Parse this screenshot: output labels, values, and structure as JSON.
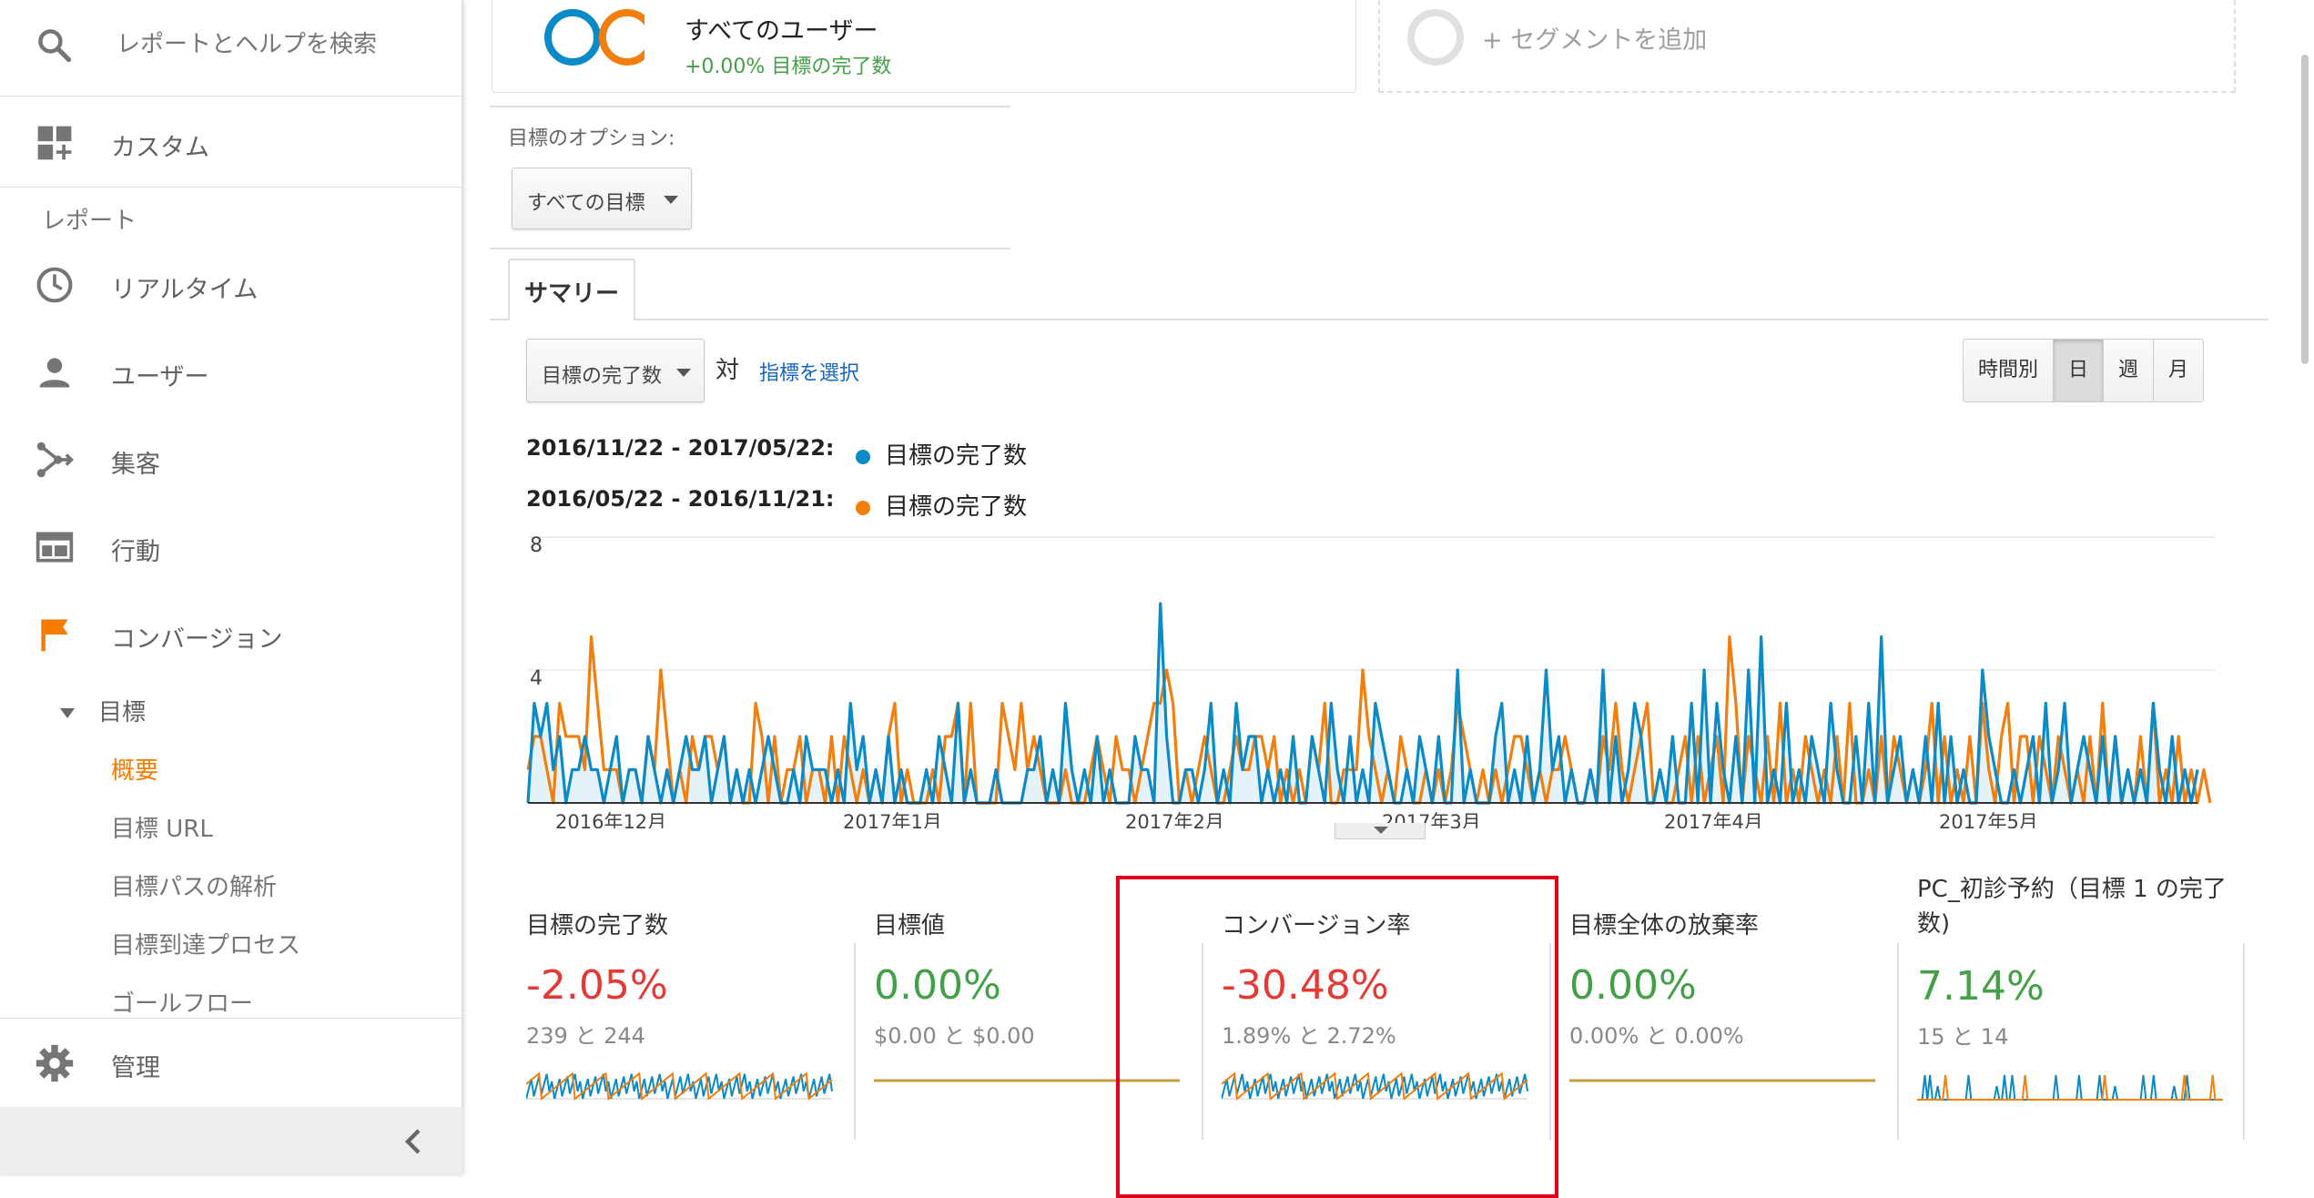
{
  "sidebar": {
    "search_label": "レポートとヘルプを検索",
    "custom_label": "カスタム",
    "reports_section": "レポート",
    "items": [
      {
        "label": "リアルタイム",
        "icon": "clock-icon"
      },
      {
        "label": "ユーザー",
        "icon": "person-icon"
      },
      {
        "label": "集客",
        "icon": "acquisition-icon"
      },
      {
        "label": "行動",
        "icon": "behavior-icon"
      },
      {
        "label": "コンバージョン",
        "icon": "flag-icon"
      }
    ],
    "goal_label": "目標",
    "goal_subitems": [
      "概要",
      "目標 URL",
      "目標パスの解析",
      "目標到達プロセス",
      "ゴールフロー"
    ],
    "admin_label": "管理",
    "accent_color": "#f57c00"
  },
  "segment": {
    "title": "すべてのユーザー",
    "subtitle": "+0.00% 目標の完了数",
    "add_label": "+ セグメントを追加"
  },
  "goal_options": {
    "label": "目標のオプション:",
    "selected": "すべての目標"
  },
  "tab": {
    "summary": "サマリー"
  },
  "controls": {
    "metric_selected": "目標の完了数",
    "vs_label": "対",
    "select_metric_link": "指標を選択",
    "time_buttons": [
      "時間別",
      "日",
      "週",
      "月"
    ],
    "selected_time": "日"
  },
  "legend": {
    "range1": "2016/11/22 - 2017/05/22:",
    "range2": "2016/05/22 - 2016/11/21:",
    "series1_name": "目標の完了数",
    "series2_name": "目標の完了数",
    "series1_color": "#0a8ac6",
    "series2_color": "#f17e0d"
  },
  "chart_data": {
    "type": "line",
    "ylabels": [
      "8",
      "4"
    ],
    "xlabels": [
      "2016年12月",
      "2017年1月",
      "2017年2月",
      "2017年3月",
      "2017年4月",
      "2017年5月"
    ],
    "ylim": [
      0,
      8
    ],
    "series": [
      {
        "values": [
          0,
          3,
          2,
          3,
          1,
          2,
          0,
          1,
          1,
          2,
          1,
          1,
          0,
          1,
          2,
          0,
          1,
          1,
          0,
          2,
          1,
          0,
          1,
          0,
          1,
          2,
          1,
          1,
          2,
          0,
          1,
          2,
          0,
          1,
          0,
          1,
          0,
          1,
          2,
          1,
          0,
          0,
          1,
          0,
          2,
          1,
          1,
          1,
          0,
          1,
          0,
          3,
          1,
          2,
          0,
          1,
          0,
          2,
          0,
          1,
          0,
          0,
          0,
          1,
          0,
          2,
          1,
          0,
          3,
          0,
          1,
          0,
          0,
          0,
          1,
          0,
          0,
          0,
          0,
          1,
          1,
          2,
          0,
          1,
          0,
          3,
          1,
          0,
          1,
          0,
          2,
          0,
          1,
          0,
          0,
          0,
          2,
          1,
          1,
          0,
          6,
          2,
          0,
          0,
          1,
          1,
          0,
          1,
          3,
          0,
          1,
          0,
          3,
          1,
          2,
          2,
          0,
          1,
          0,
          1,
          0,
          2,
          0,
          0,
          2,
          1,
          0,
          3,
          1,
          0,
          2,
          0,
          1,
          0,
          3,
          2,
          1,
          0,
          0,
          1,
          0,
          2,
          1,
          0,
          2,
          0,
          0,
          4,
          0,
          1,
          0,
          0,
          0,
          2,
          3,
          0,
          1,
          0,
          2,
          0,
          1,
          4,
          1,
          2,
          0,
          1,
          0,
          0,
          1,
          0,
          4,
          0,
          2,
          0,
          1,
          3,
          2,
          0,
          0,
          1,
          0,
          2,
          0,
          0,
          3,
          0,
          4,
          0,
          3,
          1,
          0,
          2,
          0,
          4,
          0,
          5,
          0,
          1,
          0,
          3,
          0,
          1,
          0,
          2,
          1,
          0,
          3,
          1,
          0,
          0,
          2,
          0,
          3,
          0,
          5,
          0,
          1,
          2,
          0,
          1,
          0,
          2,
          0,
          3,
          0,
          2,
          0,
          1,
          0,
          0,
          4,
          2,
          1,
          0,
          0,
          1,
          0,
          1,
          2,
          0,
          3,
          0,
          1,
          3,
          0,
          1,
          2,
          1,
          0,
          2,
          0,
          2,
          0,
          1,
          0,
          1,
          0,
          3,
          1,
          0,
          2,
          0,
          1,
          0,
          1
        ]
      },
      {
        "values": [
          1,
          2,
          2,
          1,
          0,
          3,
          2,
          2,
          2,
          1,
          5,
          3,
          1,
          1,
          1,
          0,
          1,
          1,
          0,
          2,
          1,
          4,
          2,
          0,
          1,
          0,
          2,
          1,
          2,
          2,
          1,
          2,
          0,
          1,
          0,
          0,
          3,
          2,
          0,
          2,
          0,
          1,
          1,
          2,
          0,
          1,
          1,
          0,
          2,
          0,
          2,
          1,
          0,
          1,
          0,
          1,
          0,
          2,
          3,
          0,
          1,
          0,
          0,
          0,
          1,
          0,
          2,
          2,
          3,
          0,
          3,
          0,
          0,
          0,
          0,
          3,
          2,
          1,
          3,
          1,
          2,
          1,
          0,
          0,
          0,
          1,
          0,
          0,
          0,
          1,
          2,
          1,
          0,
          2,
          1,
          1,
          0,
          1,
          2,
          3,
          3,
          4,
          3,
          0,
          1,
          0,
          1,
          2,
          1,
          0,
          0,
          1,
          2,
          1,
          1,
          2,
          2,
          1,
          2,
          0,
          1,
          0,
          1,
          0,
          2,
          1,
          3,
          0,
          0,
          1,
          1,
          1,
          4,
          2,
          1,
          0,
          1,
          0,
          2,
          1,
          0,
          0,
          1,
          0,
          1,
          0,
          1,
          3,
          2,
          1,
          0,
          1,
          0,
          1,
          0,
          1,
          2,
          2,
          1,
          0,
          1,
          0,
          1,
          1,
          2,
          1,
          0,
          0,
          1,
          0,
          2,
          1,
          3,
          1,
          0,
          1,
          2,
          3,
          0,
          1,
          0,
          0,
          1,
          2,
          0,
          2,
          0,
          1,
          2,
          0,
          5,
          3,
          0,
          2,
          1,
          0,
          2,
          0,
          3,
          0,
          1,
          0,
          2,
          1,
          0,
          1,
          0,
          2,
          0,
          3,
          0,
          0,
          1,
          0,
          2,
          0,
          2,
          1,
          0,
          1,
          0,
          1,
          3,
          0,
          2,
          0,
          1,
          0,
          2,
          0,
          3,
          1,
          0,
          2,
          3,
          0,
          2,
          2,
          0,
          2,
          1,
          0,
          2,
          1,
          0,
          1,
          0,
          2,
          0,
          3,
          0,
          2,
          0,
          1,
          0,
          2,
          0,
          3,
          0,
          1,
          0,
          2,
          0,
          1,
          0,
          1,
          0
        ]
      }
    ]
  },
  "scorecards": [
    {
      "title": "目標の完了数",
      "value": "-2.05%",
      "trend": "neg",
      "compare": "239 と 244",
      "spark": "noisy"
    },
    {
      "title": "目標値",
      "value": "0.00%",
      "trend": "pos",
      "compare": "$0.00 と $0.00",
      "spark": "flat"
    },
    {
      "title": "コンバージョン率",
      "value": "-30.48%",
      "trend": "neg",
      "compare": "1.89% と 2.72%",
      "spark": "noisy"
    },
    {
      "title": "目標全体の放棄率",
      "value": "0.00%",
      "trend": "pos",
      "compare": "0.00% と 0.00%",
      "spark": "flat"
    },
    {
      "title": "PC_初診予約（目標 1 の完了数)",
      "value": "7.14%",
      "trend": "pos",
      "compare": "15 と 14",
      "spark": "sparse"
    }
  ]
}
